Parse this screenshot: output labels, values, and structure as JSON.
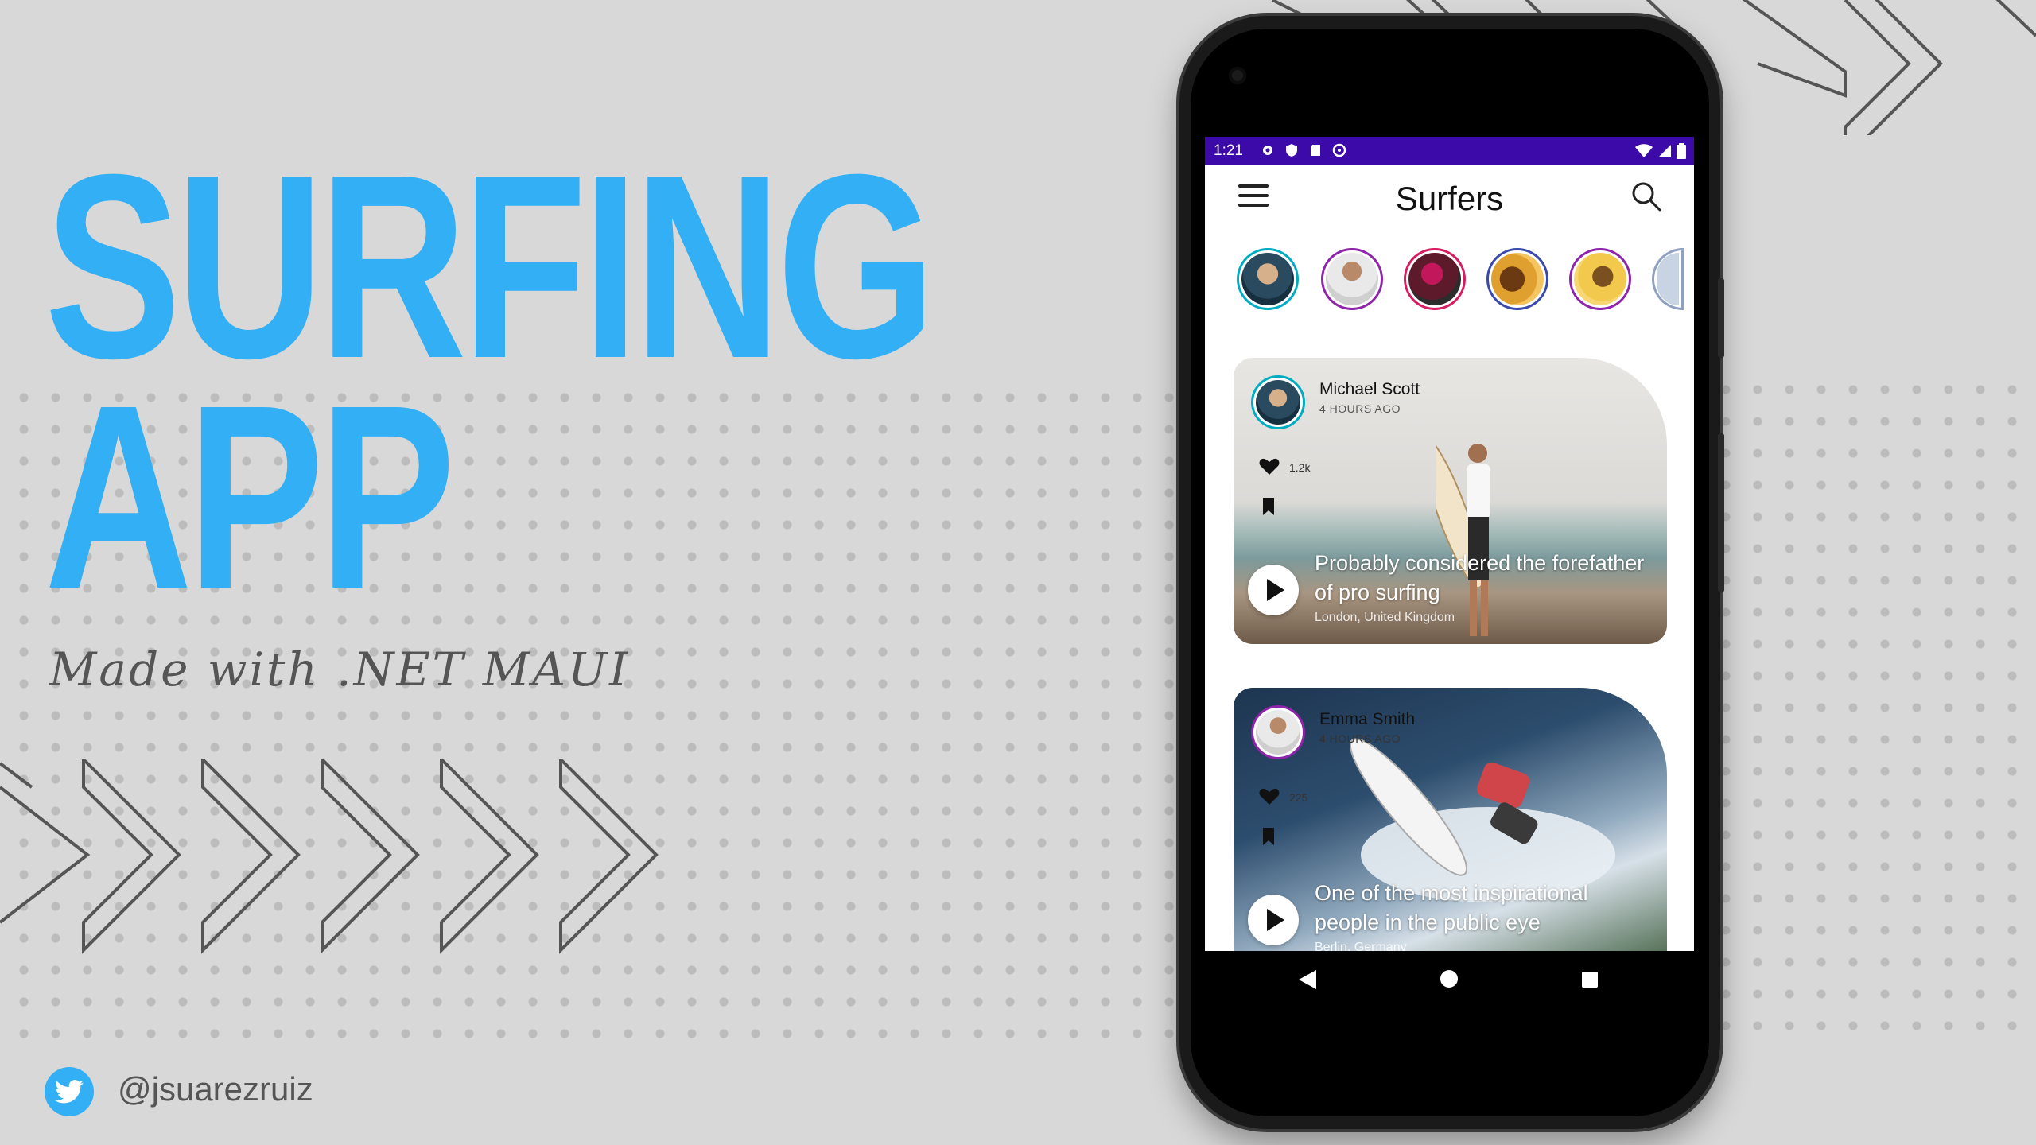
{
  "promo": {
    "title_line1": "SURFING",
    "title_line2": "APP",
    "subtitle": "Made with .NET MAUI",
    "twitter_handle": "@jsuarezruiz"
  },
  "colors": {
    "accent": "#33b0f5",
    "background": "#d8d8d8",
    "statusbar": "#3c0aa8"
  },
  "phone": {
    "status_bar": {
      "time": "1:21"
    },
    "app_bar": {
      "title": "Surfers",
      "menu_icon": "hamburger-icon",
      "search_icon": "search-icon"
    },
    "stories": [
      {
        "name": "story-1",
        "ring": "#00acc1"
      },
      {
        "name": "story-2",
        "ring": "#8e24aa"
      },
      {
        "name": "story-3",
        "ring": "#d81b60"
      },
      {
        "name": "story-4",
        "ring": "#3949ab"
      },
      {
        "name": "story-5",
        "ring": "#8e24aa"
      }
    ],
    "posts": [
      {
        "author": "Michael Scott",
        "time": "4 HOURS AGO",
        "likes": "1.2k",
        "caption": "Probably considered the forefather of pro surfing",
        "location": "London, United Kingdom"
      },
      {
        "author": "Emma Smith",
        "time": "4 HOURS AGO",
        "likes": "225",
        "caption": "One of the most inspirational people in the public eye",
        "location": "Berlin, Germany"
      }
    ]
  }
}
